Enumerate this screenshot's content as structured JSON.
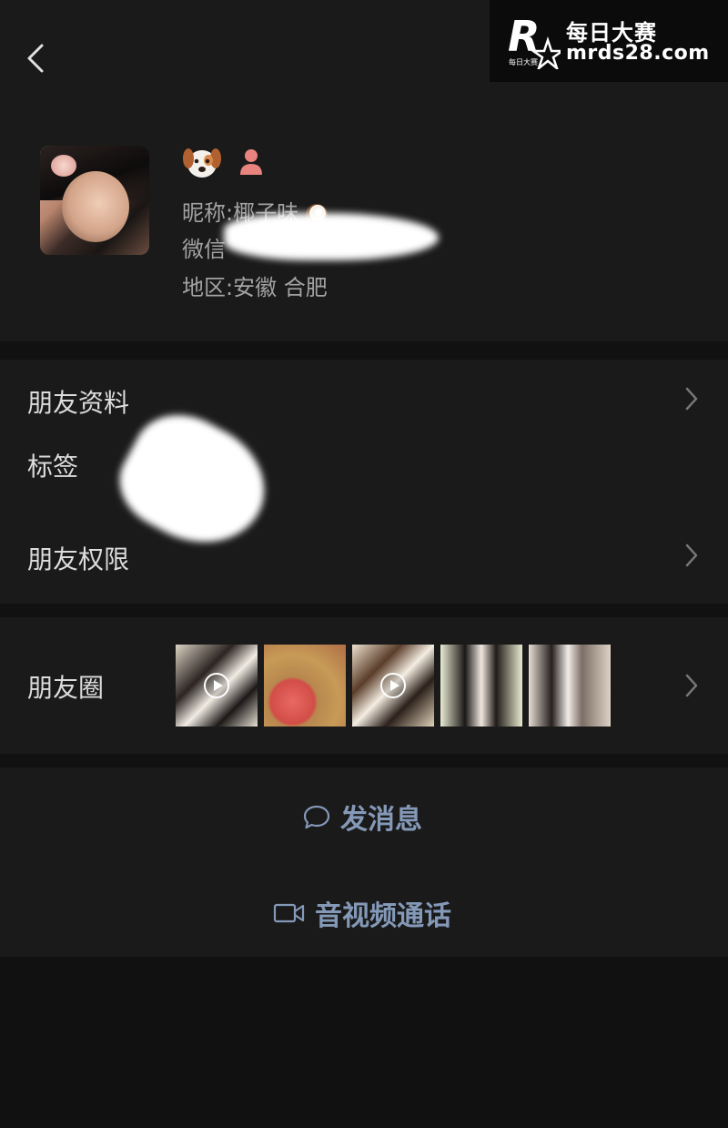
{
  "watermark": {
    "title": "每日大赛",
    "url": "mrds28.com",
    "logo_letter": "R",
    "logo_small": "每日大赛"
  },
  "profile": {
    "nickname_label": "昵称:椰子味",
    "wechat_label": "微信",
    "region_label": "地区:安徽 合肥",
    "badge_icon": "dog-face-icon",
    "gender_icon": "female-person-icon",
    "nickname_emoji_icon": "coconut-icon"
  },
  "menu": {
    "friend_info": "朋友资料",
    "tags": "标签",
    "friend_permissions": "朋友权限"
  },
  "moments": {
    "label": "朋友圈",
    "thumbnails": [
      {
        "type": "video"
      },
      {
        "type": "photo"
      },
      {
        "type": "video"
      },
      {
        "type": "photo"
      },
      {
        "type": "photo"
      }
    ]
  },
  "actions": {
    "send_message": "发消息",
    "video_call": "音视频通话"
  },
  "colors": {
    "background": "#111111",
    "panel": "#1a1a1a",
    "action_text": "#8499b8",
    "label_text": "#dcdcdc",
    "secondary_text": "#a2a2a2"
  }
}
